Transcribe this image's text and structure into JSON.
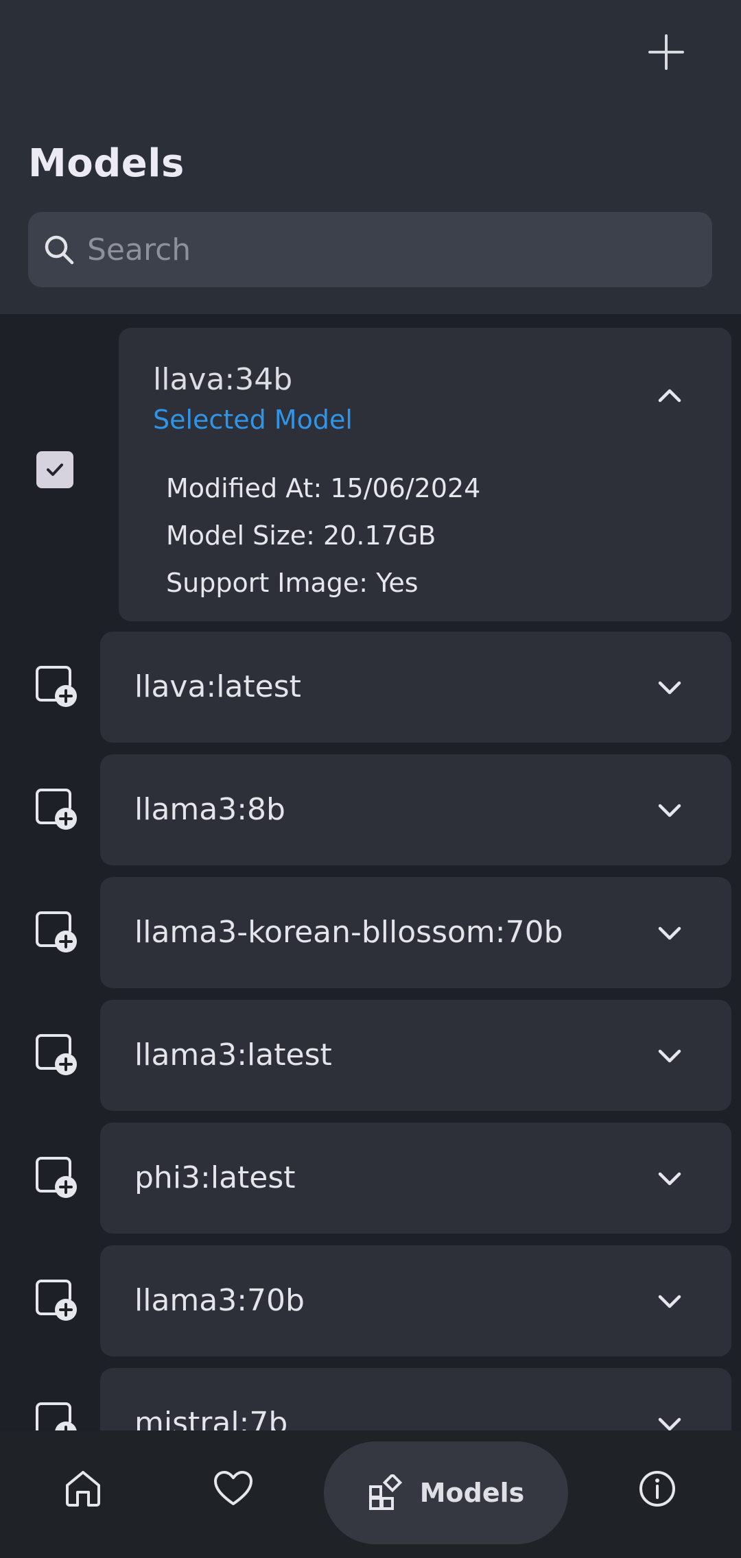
{
  "header": {
    "title": "Models",
    "search_placeholder": "Search"
  },
  "selected_model": {
    "name": "llava:34b",
    "subtitle": "Selected Model",
    "details": [
      "Modified At: 15/06/2024",
      "Model Size: 20.17GB",
      "Support Image: Yes"
    ]
  },
  "models": [
    {
      "name": "llava:latest"
    },
    {
      "name": "llama3:8b"
    },
    {
      "name": "llama3-korean-bllossom:70b"
    },
    {
      "name": "llama3:latest"
    },
    {
      "name": "phi3:latest"
    },
    {
      "name": "llama3:70b"
    },
    {
      "name": "mistral:7b"
    }
  ],
  "bottom_nav": {
    "active_label": "Models",
    "items": [
      "home-icon",
      "heart-icon",
      "models-icon",
      "info-icon"
    ]
  },
  "colors": {
    "accent": "#2f95e8",
    "header_bg": "#2b2f38",
    "card_bg": "#2d3039",
    "page_bg": "#1d2026"
  }
}
